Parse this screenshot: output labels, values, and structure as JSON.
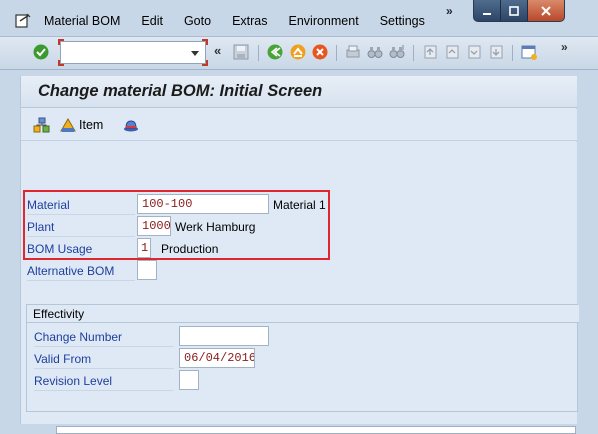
{
  "menubar": {
    "items": [
      {
        "label": "Material BOM",
        "underline": "M"
      },
      {
        "label": "Edit",
        "underline": "E"
      },
      {
        "label": "Goto",
        "underline": "G"
      },
      {
        "label": "Extras",
        "underline": "x"
      },
      {
        "label": "Environment",
        "underline": "n"
      },
      {
        "label": "Settings",
        "underline": "S"
      }
    ],
    "more": "»"
  },
  "toolbar": {
    "command_field_value": "",
    "collapse_glyph": "«",
    "more_glyph": "»"
  },
  "screen": {
    "title": "Change material BOM: Initial Screen",
    "item_button_label": "Item"
  },
  "form": {
    "material_label": "Material",
    "material_value": "100-100",
    "material_desc": "Material 1",
    "plant_label": "Plant",
    "plant_value": "1000",
    "plant_desc": "Werk Hamburg",
    "bom_usage_label": "BOM Usage",
    "bom_usage_value": "1",
    "bom_usage_desc": "Production",
    "alt_bom_label": "Alternative BOM",
    "alt_bom_value": ""
  },
  "effectivity": {
    "title": "Effectivity",
    "change_number_label": "Change Number",
    "change_number_value": "",
    "valid_from_label": "Valid From",
    "valid_from_value": "06/04/2016",
    "revision_level_label": "Revision Level",
    "revision_level_value": ""
  },
  "colors": {
    "highlight": "#e0262f",
    "label_blue": "#1d3f9e",
    "value_red": "#8a1c1c",
    "background": "#dfe9f5"
  }
}
